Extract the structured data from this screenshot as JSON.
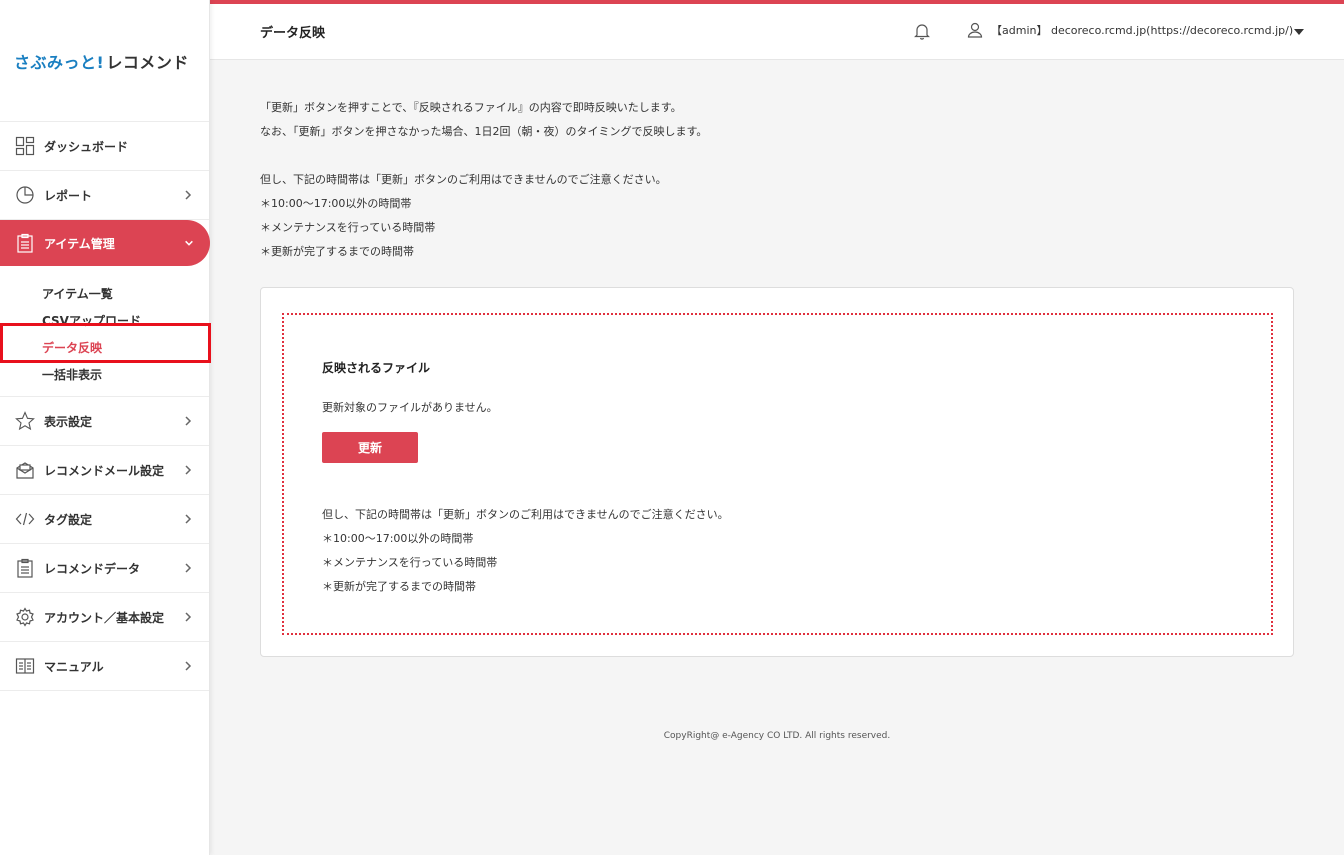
{
  "logo": {
    "part1": "さぶみっと!",
    "part2": "レコメンド"
  },
  "sidebar": {
    "items": [
      {
        "label": "ダッシュボード",
        "icon": "dashboard-icon"
      },
      {
        "label": "レポート",
        "icon": "pie-chart-icon"
      },
      {
        "label": "アイテム管理",
        "icon": "clipboard-icon"
      },
      {
        "label": "表示設定",
        "icon": "star-icon"
      },
      {
        "label": "レコメンドメール設定",
        "icon": "mail-icon"
      },
      {
        "label": "タグ設定",
        "icon": "code-icon"
      },
      {
        "label": "レコメンドデータ",
        "icon": "clipboard-icon"
      },
      {
        "label": "アカウント／基本設定",
        "icon": "gear-icon"
      },
      {
        "label": "マニュアル",
        "icon": "book-icon"
      }
    ],
    "submenu": [
      {
        "label": "アイテム一覧"
      },
      {
        "label": "CSVアップロード"
      },
      {
        "label": "データ反映"
      },
      {
        "label": "一括非表示"
      }
    ]
  },
  "header": {
    "title": "データ反映",
    "user": "【admin】 decoreco.rcmd.jp(https://decoreco.rcmd.jp/)"
  },
  "intro": {
    "line1": "「更新」ボタンを押すことで、『反映されるファイル』の内容で即時反映いたします。",
    "line2": "なお、「更新」ボタンを押さなかった場合、1日2回（朝・夜）のタイミングで反映します。",
    "line3": "但し、下記の時間帯は「更新」ボタンのご利用はできませんのでご注意ください。",
    "line4": "＊10:00～17:00以外の時間帯",
    "line5": "＊メンテナンスを行っている時間帯",
    "line6": "＊更新が完了するまでの時間帯"
  },
  "card": {
    "file_title": "反映されるファイル",
    "no_file": "更新対象のファイルがありません。",
    "update_label": "更新",
    "note1": "但し、下記の時間帯は「更新」ボタンのご利用はできませんのでご注意ください。",
    "note2": "＊10:00～17:00以外の時間帯",
    "note3": "＊メンテナンスを行っている時間帯",
    "note4": "＊更新が完了するまでの時間帯"
  },
  "footer": {
    "copyright": "CopyRight@ e-Agency CO LTD. All rights reserved."
  },
  "colors": {
    "accent": "#dc4453",
    "logo_blue": "#1a7fc1",
    "highlight": "#e8101c"
  }
}
